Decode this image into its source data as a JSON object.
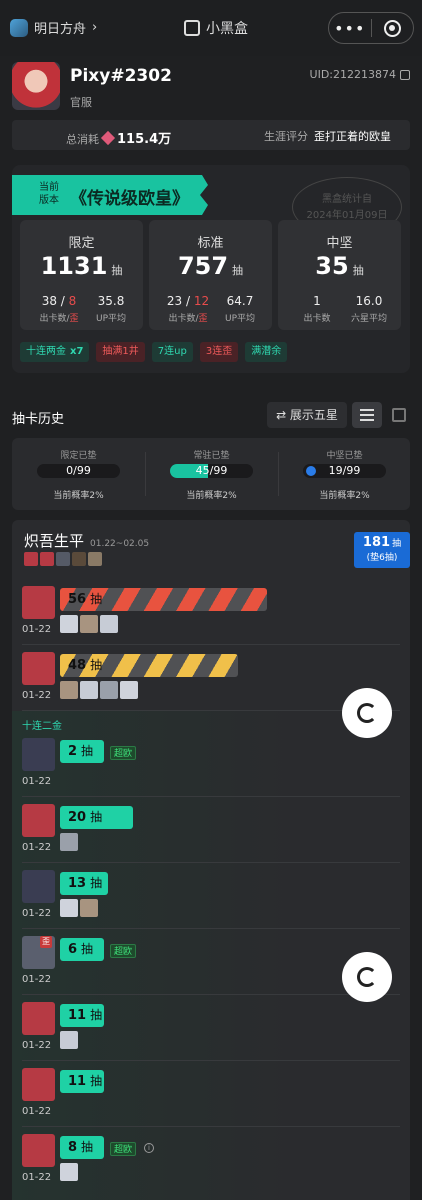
{
  "topbar": {
    "game": "明日方舟",
    "chevron": "›",
    "brand": "小黑盒",
    "more": "•••"
  },
  "profile": {
    "name": "Pixy#2302",
    "server": "官服",
    "uid": "UID:212213874"
  },
  "stats": {
    "total_label": "总消耗",
    "total_value": "115.4万",
    "rating_label": "生涯评分",
    "rating_value": "歪打正着的欧皇"
  },
  "summary": {
    "version_label": "当前\n版本",
    "title": "《传说级欧皇》",
    "stamp_line1": "黑盒统计自",
    "stamp_line2": "2024年01月09日",
    "pools": [
      {
        "name": "限定",
        "count": "1131",
        "unit": "抽",
        "pulls_a": "38 / ",
        "pulls_b": "8",
        "cap_a": "出卡数/",
        "cap_b": "歪",
        "avg": "35.8",
        "avg_label": "UP平均"
      },
      {
        "name": "标准",
        "count": "757",
        "unit": "抽",
        "pulls_a": "23 / ",
        "pulls_b": "12",
        "cap_a": "出卡数/",
        "cap_b": "歪",
        "avg": "64.7",
        "avg_label": "UP平均"
      },
      {
        "name": "中坚",
        "count": "35",
        "unit": "抽",
        "pulls_a": "1",
        "pulls_b": "",
        "cap_a": "出卡数",
        "cap_b": "",
        "avg": "16.0",
        "avg_label": "六星平均"
      }
    ],
    "tags": [
      {
        "label": "十连两金",
        "extra": "x7",
        "color": "green"
      },
      {
        "label": "抽满1井",
        "extra": "",
        "color": "red"
      },
      {
        "label": "7连up",
        "extra": "",
        "color": "green"
      },
      {
        "label": "3连歪",
        "extra": "",
        "color": "red"
      },
      {
        "label": "满潜余",
        "extra": "",
        "color": "green"
      }
    ]
  },
  "history": {
    "title": "抽卡历史",
    "show_five": "⇄ 展示五星",
    "pity": [
      {
        "label": "限定已垫",
        "value": "0/99",
        "fraction": 0,
        "prob": "当前概率2%"
      },
      {
        "label": "常驻已垫",
        "value": "45/99",
        "fraction": 0.4545,
        "prob": "当前概率2%"
      },
      {
        "label": "中坚已垫",
        "value": "19/99",
        "fraction": 0.19,
        "prob": "当前概率2%"
      }
    ]
  },
  "event": {
    "title": "炽吾生平",
    "dates": "01.22~02.05",
    "total": "181",
    "total_unit": "抽",
    "pad": "(垫6抽)",
    "group_label": "十连二金",
    "rows": [
      {
        "pulls": "56",
        "unit": "抽",
        "date": "01-22",
        "fraction": 0.566,
        "color": "#e8533f",
        "badge": "",
        "ops": 3
      },
      {
        "pulls": "48",
        "unit": "抽",
        "date": "01-22",
        "fraction": 0.485,
        "color": "#f0c04a",
        "badge": "",
        "ops": 4
      },
      {
        "pulls": "2",
        "unit": "抽",
        "date": "01-22",
        "fraction": 0.05,
        "color": "#1fd1a5",
        "badge": "超欧",
        "ops": 0
      },
      {
        "pulls": "20",
        "unit": "抽",
        "date": "01-22",
        "fraction": 0.2,
        "color": "#1fd1a5",
        "badge": "",
        "ops": 1
      },
      {
        "pulls": "13",
        "unit": "抽",
        "date": "01-22",
        "fraction": 0.13,
        "color": "#1fd1a5",
        "badge": "",
        "ops": 2
      },
      {
        "pulls": "6",
        "unit": "抽",
        "date": "01-22",
        "fraction": 0.06,
        "color": "#1fd1a5",
        "badge": "超欧",
        "ops": 0,
        "wai": "歪"
      },
      {
        "pulls": "11",
        "unit": "抽",
        "date": "01-22",
        "fraction": 0.11,
        "color": "#1fd1a5",
        "badge": "",
        "ops": 1
      },
      {
        "pulls": "11",
        "unit": "抽",
        "date": "01-22",
        "fraction": 0.11,
        "color": "#1fd1a5",
        "badge": "",
        "ops": 0
      },
      {
        "pulls": "8",
        "unit": "抽",
        "date": "01-22",
        "fraction": 0.08,
        "color": "#1fd1a5",
        "badge": "超欧",
        "ops": 1,
        "info": "i"
      }
    ]
  }
}
